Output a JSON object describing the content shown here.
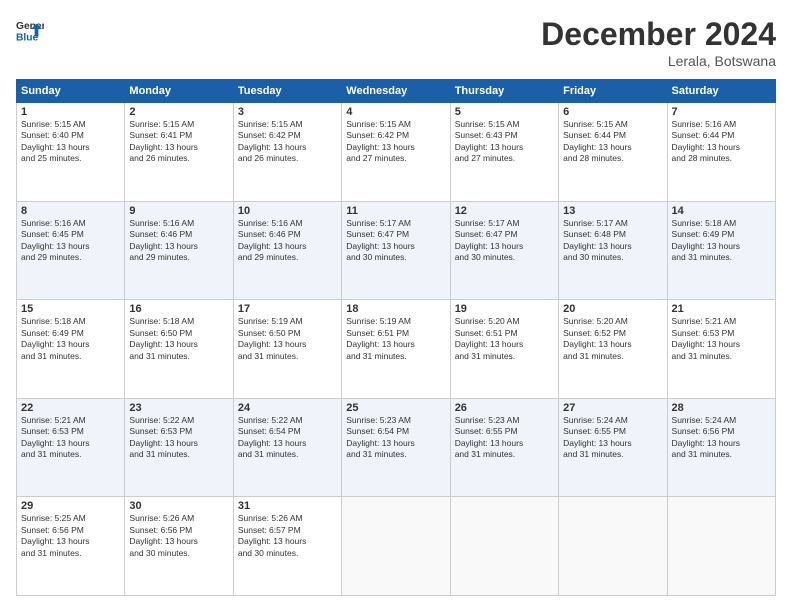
{
  "header": {
    "logo_line1": "General",
    "logo_line2": "Blue",
    "month": "December 2024",
    "location": "Lerala, Botswana"
  },
  "days_of_week": [
    "Sunday",
    "Monday",
    "Tuesday",
    "Wednesday",
    "Thursday",
    "Friday",
    "Saturday"
  ],
  "weeks": [
    [
      {
        "day": "1",
        "info": "Sunrise: 5:15 AM\nSunset: 6:40 PM\nDaylight: 13 hours\nand 25 minutes."
      },
      {
        "day": "2",
        "info": "Sunrise: 5:15 AM\nSunset: 6:41 PM\nDaylight: 13 hours\nand 26 minutes."
      },
      {
        "day": "3",
        "info": "Sunrise: 5:15 AM\nSunset: 6:42 PM\nDaylight: 13 hours\nand 26 minutes."
      },
      {
        "day": "4",
        "info": "Sunrise: 5:15 AM\nSunset: 6:42 PM\nDaylight: 13 hours\nand 27 minutes."
      },
      {
        "day": "5",
        "info": "Sunrise: 5:15 AM\nSunset: 6:43 PM\nDaylight: 13 hours\nand 27 minutes."
      },
      {
        "day": "6",
        "info": "Sunrise: 5:15 AM\nSunset: 6:44 PM\nDaylight: 13 hours\nand 28 minutes."
      },
      {
        "day": "7",
        "info": "Sunrise: 5:16 AM\nSunset: 6:44 PM\nDaylight: 13 hours\nand 28 minutes."
      }
    ],
    [
      {
        "day": "8",
        "info": "Sunrise: 5:16 AM\nSunset: 6:45 PM\nDaylight: 13 hours\nand 29 minutes."
      },
      {
        "day": "9",
        "info": "Sunrise: 5:16 AM\nSunset: 6:46 PM\nDaylight: 13 hours\nand 29 minutes."
      },
      {
        "day": "10",
        "info": "Sunrise: 5:16 AM\nSunset: 6:46 PM\nDaylight: 13 hours\nand 29 minutes."
      },
      {
        "day": "11",
        "info": "Sunrise: 5:17 AM\nSunset: 6:47 PM\nDaylight: 13 hours\nand 30 minutes."
      },
      {
        "day": "12",
        "info": "Sunrise: 5:17 AM\nSunset: 6:47 PM\nDaylight: 13 hours\nand 30 minutes."
      },
      {
        "day": "13",
        "info": "Sunrise: 5:17 AM\nSunset: 6:48 PM\nDaylight: 13 hours\nand 30 minutes."
      },
      {
        "day": "14",
        "info": "Sunrise: 5:18 AM\nSunset: 6:49 PM\nDaylight: 13 hours\nand 31 minutes."
      }
    ],
    [
      {
        "day": "15",
        "info": "Sunrise: 5:18 AM\nSunset: 6:49 PM\nDaylight: 13 hours\nand 31 minutes."
      },
      {
        "day": "16",
        "info": "Sunrise: 5:18 AM\nSunset: 6:50 PM\nDaylight: 13 hours\nand 31 minutes."
      },
      {
        "day": "17",
        "info": "Sunrise: 5:19 AM\nSunset: 6:50 PM\nDaylight: 13 hours\nand 31 minutes."
      },
      {
        "day": "18",
        "info": "Sunrise: 5:19 AM\nSunset: 6:51 PM\nDaylight: 13 hours\nand 31 minutes."
      },
      {
        "day": "19",
        "info": "Sunrise: 5:20 AM\nSunset: 6:51 PM\nDaylight: 13 hours\nand 31 minutes."
      },
      {
        "day": "20",
        "info": "Sunrise: 5:20 AM\nSunset: 6:52 PM\nDaylight: 13 hours\nand 31 minutes."
      },
      {
        "day": "21",
        "info": "Sunrise: 5:21 AM\nSunset: 6:53 PM\nDaylight: 13 hours\nand 31 minutes."
      }
    ],
    [
      {
        "day": "22",
        "info": "Sunrise: 5:21 AM\nSunset: 6:53 PM\nDaylight: 13 hours\nand 31 minutes."
      },
      {
        "day": "23",
        "info": "Sunrise: 5:22 AM\nSunset: 6:53 PM\nDaylight: 13 hours\nand 31 minutes."
      },
      {
        "day": "24",
        "info": "Sunrise: 5:22 AM\nSunset: 6:54 PM\nDaylight: 13 hours\nand 31 minutes."
      },
      {
        "day": "25",
        "info": "Sunrise: 5:23 AM\nSunset: 6:54 PM\nDaylight: 13 hours\nand 31 minutes."
      },
      {
        "day": "26",
        "info": "Sunrise: 5:23 AM\nSunset: 6:55 PM\nDaylight: 13 hours\nand 31 minutes."
      },
      {
        "day": "27",
        "info": "Sunrise: 5:24 AM\nSunset: 6:55 PM\nDaylight: 13 hours\nand 31 minutes."
      },
      {
        "day": "28",
        "info": "Sunrise: 5:24 AM\nSunset: 6:56 PM\nDaylight: 13 hours\nand 31 minutes."
      }
    ],
    [
      {
        "day": "29",
        "info": "Sunrise: 5:25 AM\nSunset: 6:56 PM\nDaylight: 13 hours\nand 31 minutes."
      },
      {
        "day": "30",
        "info": "Sunrise: 5:26 AM\nSunset: 6:56 PM\nDaylight: 13 hours\nand 30 minutes."
      },
      {
        "day": "31",
        "info": "Sunrise: 5:26 AM\nSunset: 6:57 PM\nDaylight: 13 hours\nand 30 minutes."
      },
      null,
      null,
      null,
      null
    ]
  ]
}
